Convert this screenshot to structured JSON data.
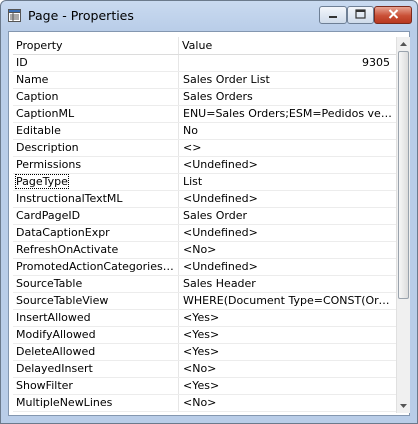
{
  "window": {
    "title": "Page - Properties",
    "icon": "properties-window-icon"
  },
  "controls": {
    "minimize_icon": "minimize-icon",
    "maximize_icon": "maximize-icon",
    "close_icon": "close-icon"
  },
  "grid": {
    "headers": {
      "property": "Property",
      "value": "Value"
    },
    "rows": [
      {
        "property": "ID",
        "value": "9305",
        "align": "right"
      },
      {
        "property": "Name",
        "value": "Sales Order List"
      },
      {
        "property": "Caption",
        "value": "Sales Orders"
      },
      {
        "property": "CaptionML",
        "value": "ENU=Sales Orders;ESM=Pedidos venta;FRC=Commandes vente"
      },
      {
        "property": "Editable",
        "value": "No"
      },
      {
        "property": "Description",
        "value": "<>"
      },
      {
        "property": "Permissions",
        "value": "<Undefined>"
      },
      {
        "property": "PageType",
        "value": "List",
        "selected": true
      },
      {
        "property": "InstructionalTextML",
        "value": "<Undefined>"
      },
      {
        "property": "CardPageID",
        "value": "Sales Order"
      },
      {
        "property": "DataCaptionExpr",
        "value": "<Undefined>"
      },
      {
        "property": "RefreshOnActivate",
        "value": "<No>"
      },
      {
        "property": "PromotedActionCategoriesML",
        "value": "<Undefined>"
      },
      {
        "property": "SourceTable",
        "value": "Sales Header"
      },
      {
        "property": "SourceTableView",
        "value": "WHERE(Document Type=CONST(Order))"
      },
      {
        "property": "InsertAllowed",
        "value": "<Yes>"
      },
      {
        "property": "ModifyAllowed",
        "value": "<Yes>"
      },
      {
        "property": "DeleteAllowed",
        "value": "<Yes>"
      },
      {
        "property": "DelayedInsert",
        "value": "<No>"
      },
      {
        "property": "ShowFilter",
        "value": "<Yes>"
      },
      {
        "property": "MultipleNewLines",
        "value": "<No>"
      }
    ]
  },
  "colors": {
    "titlebar": "#b9cde8",
    "close_button": "#c94f36",
    "grid_line": "#ececec"
  }
}
